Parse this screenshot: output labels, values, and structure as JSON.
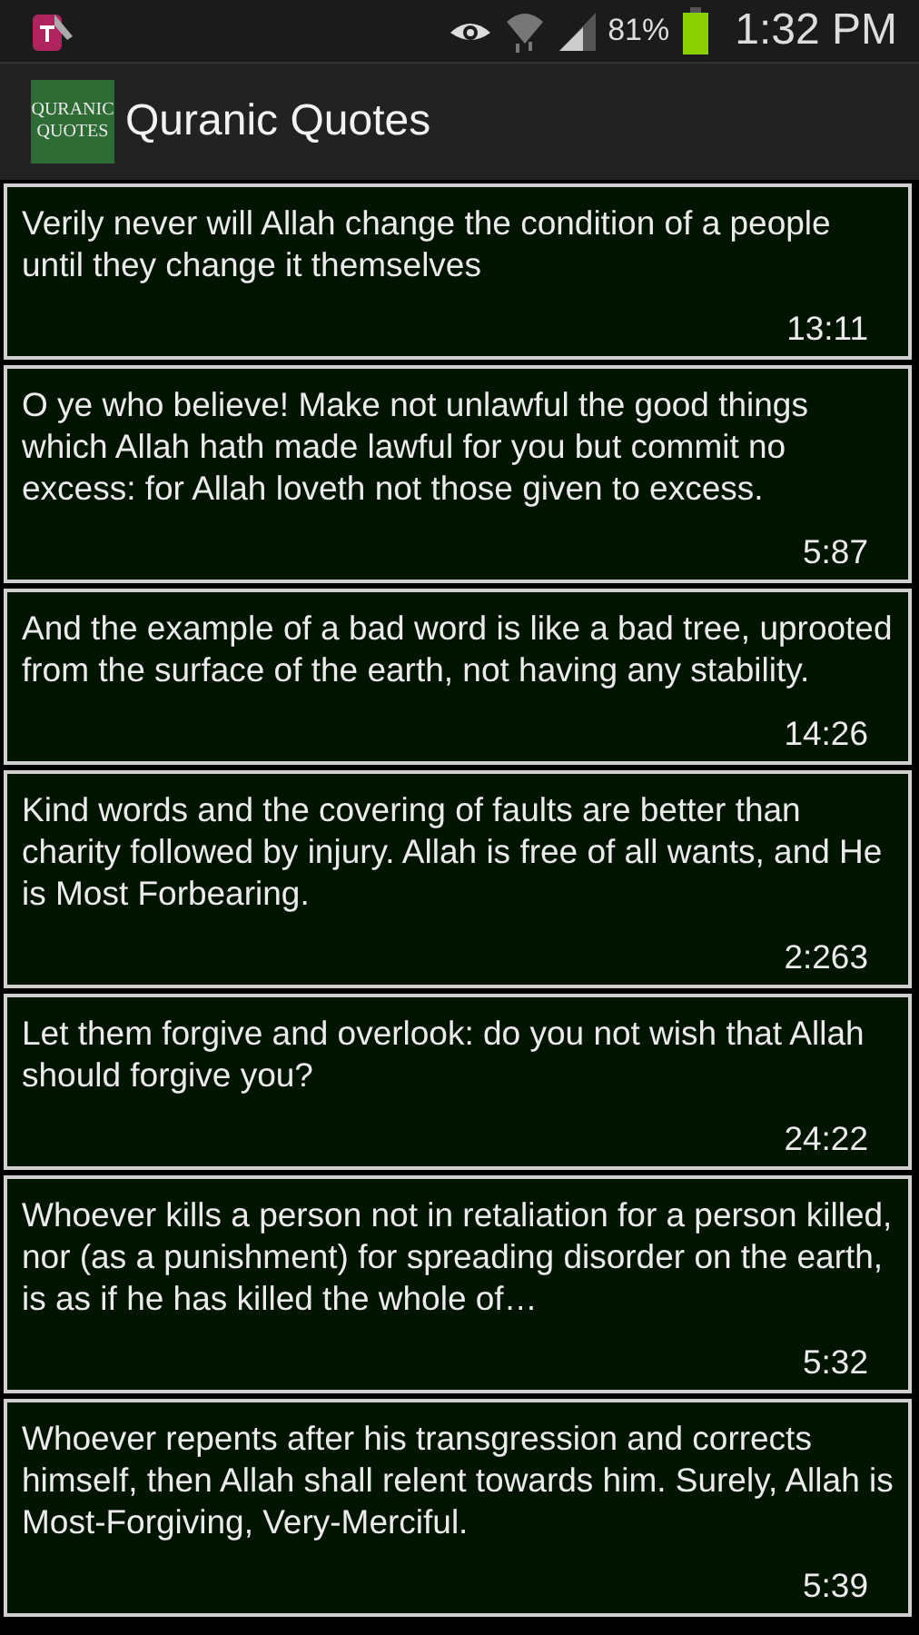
{
  "status_bar": {
    "battery": "81%",
    "time": "1:32 PM"
  },
  "app_bar": {
    "logo_lines": [
      "QURANIC",
      "QUOTES"
    ],
    "title": "Quranic Quotes"
  },
  "quotes": [
    {
      "text": "Verily never will Allah change the condition of a people until they change it themselves",
      "reference": "13:11"
    },
    {
      "text": "O ye who believe! Make not unlawful the good things which Allah hath made lawful for you but commit no excess: for Allah loveth not those given to excess.",
      "reference": "5:87"
    },
    {
      "text": "And the example of a bad word is like a bad tree, uprooted from the surface of the earth, not having any stability.",
      "reference": "14:26"
    },
    {
      "text": "Kind words and the covering of faults are better than charity followed by injury. Allah is free of all wants, and He is Most Forbearing.",
      "reference": "2:263"
    },
    {
      "text": "Let them forgive and overlook: do you not wish that Allah should forgive you?",
      "reference": "24:22"
    },
    {
      "text": "Whoever kills a person not in retaliation for a person killed, nor (as a punishment) for spreading disorder on the earth, is as if he has killed the whole of…",
      "reference": "5:32"
    },
    {
      "text": "Whoever repents after his transgression and corrects himself, then Allah shall relent towards him. Surely, Allah is Most-Forgiving, Very-Merciful.",
      "reference": "5:39"
    }
  ]
}
